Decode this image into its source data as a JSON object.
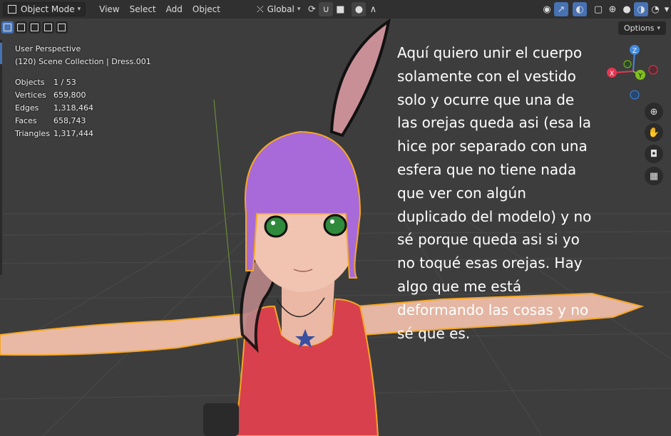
{
  "header": {
    "mode": "Object Mode",
    "menus": [
      "View",
      "Select",
      "Add",
      "Object"
    ],
    "orientation": "Global",
    "options_label": "Options"
  },
  "overlay": {
    "perspective": "User Perspective",
    "collection": "(120) Scene Collection | Dress.001",
    "stats": [
      {
        "label": "Objects",
        "value": "1 / 53"
      },
      {
        "label": "Vertices",
        "value": "659,800"
      },
      {
        "label": "Edges",
        "value": "1,318,464"
      },
      {
        "label": "Faces",
        "value": "658,743"
      },
      {
        "label": "Triangles",
        "value": "1,317,444"
      }
    ]
  },
  "annotation": {
    "lines": [
      "Aquí quiero unir el cuerpo",
      "solamente con el vestido",
      "solo y ocurre que una de",
      "las orejas queda asi (esa la",
      "hice por separado con una",
      "esfera que no tiene nada",
      "que ver con algún",
      "duplicado del modelo) y no",
      "sé porque queda asi si yo",
      "no toqué esas orejas. Hay",
      "algo que me está",
      "deformando las cosas y no",
      "sé que es."
    ]
  },
  "gizmo": {
    "z": "Z",
    "x": "X",
    "y": "Y"
  },
  "colors": {
    "accent": "#4772b3",
    "selection_outline": "#f5a623",
    "axis_x": "#e6354f",
    "axis_y": "#7fbf1f",
    "axis_z": "#3f8ae0"
  }
}
